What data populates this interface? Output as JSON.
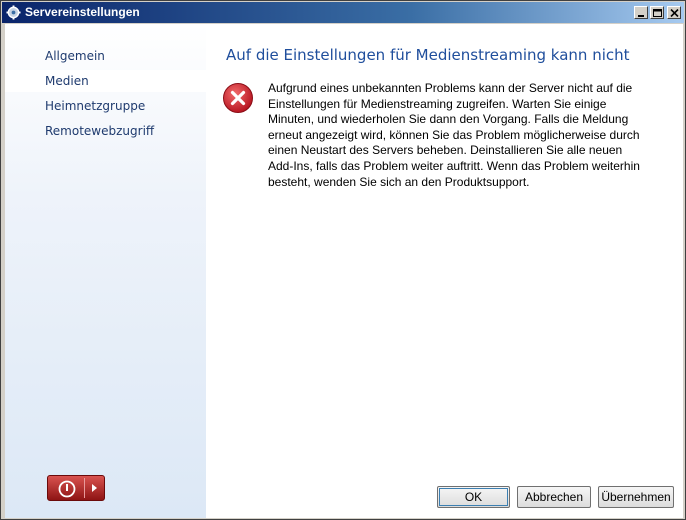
{
  "window": {
    "title": "Servereinstellungen",
    "icon": "gear-icon",
    "controls": [
      "minimize-icon",
      "maximize-icon",
      "close-icon"
    ]
  },
  "sidebar": {
    "items": [
      {
        "label": "Allgemein",
        "selected": false
      },
      {
        "label": "Medien",
        "selected": true
      },
      {
        "label": "Heimnetzgruppe",
        "selected": false
      },
      {
        "label": "Remotewebzugriff",
        "selected": false
      }
    ],
    "power_button": {
      "icon": "power-icon",
      "arrow_icon": "arrow-right-icon",
      "color": "#b01e1e"
    }
  },
  "main": {
    "heading": "Auf die Einstellungen für Medienstreaming kann nicht",
    "error_icon": "error-icon",
    "message_lines": [
      "Aufgrund eines unbekannten Problems kann der Server nicht auf die",
      "Einstellungen für Medienstreaming zugreifen. Warten Sie einige",
      "Minuten, und wiederholen Sie dann den Vorgang. Falls die Meldung",
      "erneut angezeigt wird, können Sie das Problem möglicherweise durch",
      "einen Neustart des Servers beheben. Deinstallieren Sie alle neuen",
      "Add-Ins, falls das Problem weiter auftritt. Wenn das Problem weiterhin",
      "besteht, wenden Sie sich an den Produktsupport."
    ]
  },
  "buttons": {
    "ok": "OK",
    "cancel": "Abbrechen",
    "apply": "Übernehmen"
  },
  "colors": {
    "title_bar": "#0a246a",
    "heading": "#1f4e9c",
    "nav_text": "#1e3a6e",
    "error": "#c8102e"
  }
}
